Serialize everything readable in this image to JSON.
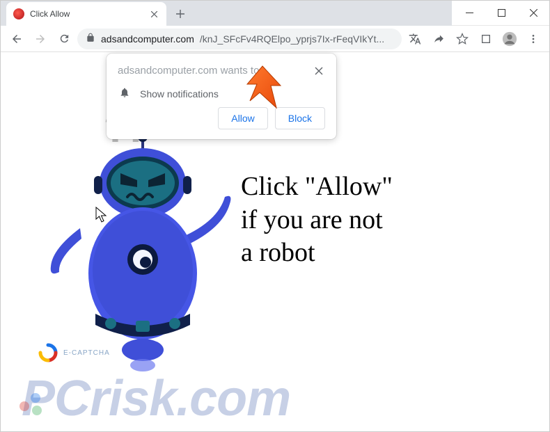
{
  "window": {
    "tab_title": "Click Allow"
  },
  "address": {
    "host": "adsandcomputer.com",
    "path": "/knJ_SFcFv4RQElpo_yprjs7Ix-rFeqVIkYt..."
  },
  "permission_prompt": {
    "title": "adsandcomputer.com wants to",
    "body": "Show notifications",
    "allow_label": "Allow",
    "block_label": "Block"
  },
  "page": {
    "main_message": "Click \"Allow\"\nif you are not\na robot",
    "captcha_label": "E-CAPTCHA",
    "question_marks": "??"
  },
  "watermark": {
    "text": "PCrisk.com"
  }
}
